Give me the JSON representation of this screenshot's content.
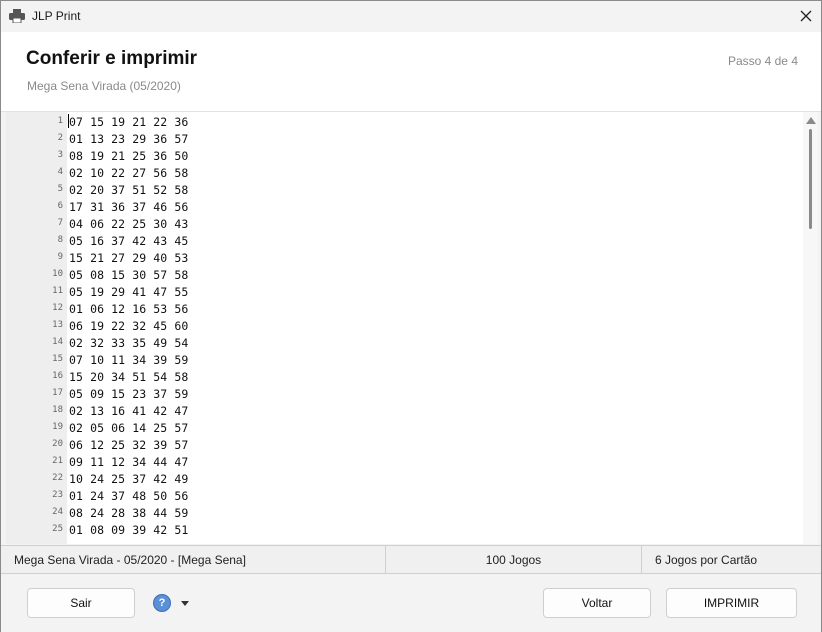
{
  "window": {
    "title": "JLP Print"
  },
  "header": {
    "title": "Conferir e imprimir",
    "subtitle": "Mega Sena Virada (05/2020)",
    "step": "Passo 4 de 4"
  },
  "editor": {
    "lines": [
      {
        "n": "1",
        "text": "07 15 19 21 22 36"
      },
      {
        "n": "2",
        "text": "01 13 23 29 36 57"
      },
      {
        "n": "3",
        "text": "08 19 21 25 36 50"
      },
      {
        "n": "4",
        "text": "02 10 22 27 56 58"
      },
      {
        "n": "5",
        "text": "02 20 37 51 52 58"
      },
      {
        "n": "6",
        "text": "17 31 36 37 46 56"
      },
      {
        "n": "7",
        "text": "04 06 22 25 30 43"
      },
      {
        "n": "8",
        "text": "05 16 37 42 43 45"
      },
      {
        "n": "9",
        "text": "15 21 27 29 40 53"
      },
      {
        "n": "10",
        "text": "05 08 15 30 57 58"
      },
      {
        "n": "11",
        "text": "05 19 29 41 47 55"
      },
      {
        "n": "12",
        "text": "01 06 12 16 53 56"
      },
      {
        "n": "13",
        "text": "06 19 22 32 45 60"
      },
      {
        "n": "14",
        "text": "02 32 33 35 49 54"
      },
      {
        "n": "15",
        "text": "07 10 11 34 39 59"
      },
      {
        "n": "16",
        "text": "15 20 34 51 54 58"
      },
      {
        "n": "17",
        "text": "05 09 15 23 37 59"
      },
      {
        "n": "18",
        "text": "02 13 16 41 42 47"
      },
      {
        "n": "19",
        "text": "02 05 06 14 25 57"
      },
      {
        "n": "20",
        "text": "06 12 25 32 39 57"
      },
      {
        "n": "21",
        "text": "09 11 12 34 44 47"
      },
      {
        "n": "22",
        "text": "10 24 25 37 42 49"
      },
      {
        "n": "23",
        "text": "01 24 37 48 50 56"
      },
      {
        "n": "24",
        "text": "08 24 28 38 44 59"
      },
      {
        "n": "25",
        "text": "01 08 09 39 42 51"
      }
    ]
  },
  "status": {
    "contest": "Mega Sena Virada - 05/2020 - [Mega Sena]",
    "games": "100 Jogos",
    "per_card": "6 Jogos por Cartão"
  },
  "footer": {
    "exit_label": "Sair",
    "help_glyph": "?",
    "back_label": "Voltar",
    "print_label": "IMPRIMIR"
  }
}
